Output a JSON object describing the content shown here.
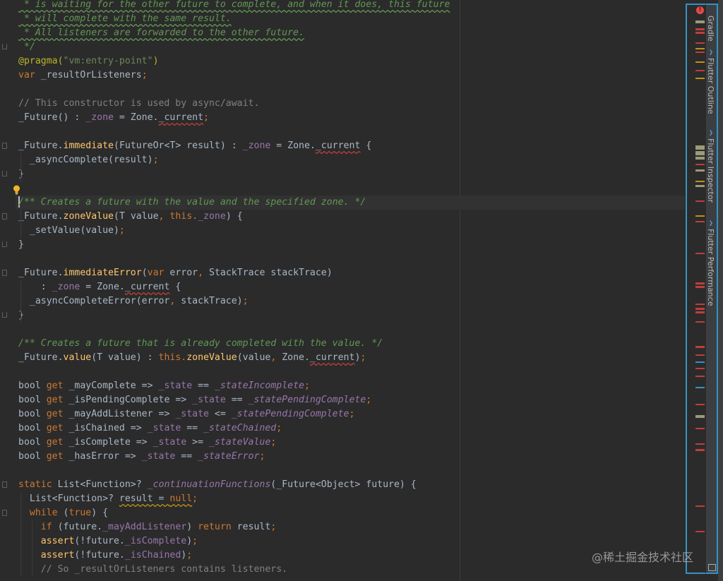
{
  "editor": {
    "lines": [
      [
        [
          "doc",
          " * is waiting for the other future to complete, and when it does, this future"
        ]
      ],
      [
        [
          "doc",
          " * will complete with the same result."
        ]
      ],
      [
        [
          "doc",
          " * All listeners are forwarded to the other future."
        ]
      ],
      [
        [
          "doc",
          " */"
        ]
      ],
      [
        [
          "ann",
          "@pragma("
        ],
        [
          "str",
          "\"vm:entry-point\""
        ],
        [
          "ann",
          ")"
        ]
      ],
      [
        [
          "kw",
          "var "
        ],
        [
          "plain",
          "_resultOrListeners"
        ],
        [
          "kw",
          ";"
        ]
      ],
      [],
      [
        [
          "cmt",
          "// This constructor is used by async/await."
        ]
      ],
      [
        [
          "plain",
          "_Future() : "
        ],
        [
          "prop-n",
          "_zone"
        ],
        [
          "plain",
          " = Zone."
        ],
        [
          "err",
          "_current"
        ],
        [
          "kw",
          ";"
        ]
      ],
      [],
      [
        [
          "plain",
          "_Future."
        ],
        [
          "fn",
          "immediate"
        ],
        [
          "plain",
          "(FutureOr<T> result) : "
        ],
        [
          "prop-n",
          "_zone"
        ],
        [
          "plain",
          " = Zone."
        ],
        [
          "err",
          "_current"
        ],
        [
          "plain",
          " {"
        ]
      ],
      [
        [
          "plain",
          "  _asyncComplete(result)"
        ],
        [
          "kw",
          ";"
        ]
      ],
      [
        [
          "plain",
          "}"
        ]
      ],
      [],
      [
        [
          "doc",
          "/** Creates a future with the value and the specified zone. */"
        ]
      ],
      [
        [
          "plain",
          "_Future."
        ],
        [
          "fn",
          "zoneValue"
        ],
        [
          "plain",
          "(T value"
        ],
        [
          "kw",
          ", this."
        ],
        [
          "prop-n",
          "_zone"
        ],
        [
          "plain",
          ") {"
        ]
      ],
      [
        [
          "plain",
          "  _setValue(value)"
        ],
        [
          "kw",
          ";"
        ]
      ],
      [
        [
          "plain",
          "}"
        ]
      ],
      [],
      [
        [
          "plain",
          "_Future."
        ],
        [
          "fn",
          "immediateError"
        ],
        [
          "plain",
          "("
        ],
        [
          "kw",
          "var "
        ],
        [
          "plain",
          "error"
        ],
        [
          "kw",
          ", "
        ],
        [
          "plain",
          "StackTrace stackTrace)"
        ]
      ],
      [
        [
          "plain",
          "    : "
        ],
        [
          "prop-n",
          "_zone"
        ],
        [
          "plain",
          " = Zone."
        ],
        [
          "err",
          "_current"
        ],
        [
          "plain",
          " {"
        ]
      ],
      [
        [
          "plain",
          "  _asyncCompleteError(error"
        ],
        [
          "kw",
          ", "
        ],
        [
          "plain",
          "stackTrace)"
        ],
        [
          "kw",
          ";"
        ]
      ],
      [
        [
          "plain",
          "}"
        ]
      ],
      [],
      [
        [
          "doc",
          "/** Creates a future that is already completed with the value. */"
        ]
      ],
      [
        [
          "plain",
          "_Future."
        ],
        [
          "fn",
          "value"
        ],
        [
          "plain",
          "(T value) : "
        ],
        [
          "kw",
          "this."
        ],
        [
          "fn",
          "zoneValue"
        ],
        [
          "plain",
          "(value"
        ],
        [
          "kw",
          ", "
        ],
        [
          "plain",
          "Zone."
        ],
        [
          "err",
          "_current"
        ],
        [
          "plain",
          ")"
        ],
        [
          "kw",
          ";"
        ]
      ],
      [],
      [
        [
          "plain",
          "bool "
        ],
        [
          "kw",
          "get "
        ],
        [
          "plain",
          "_mayComplete => "
        ],
        [
          "prop-n",
          "_state"
        ],
        [
          "plain",
          " == "
        ],
        [
          "prop",
          "_stateIncomplete"
        ],
        [
          "kw",
          ";"
        ]
      ],
      [
        [
          "plain",
          "bool "
        ],
        [
          "kw",
          "get "
        ],
        [
          "plain",
          "_isPendingComplete => "
        ],
        [
          "prop-n",
          "_state"
        ],
        [
          "plain",
          " == "
        ],
        [
          "prop",
          "_statePendingComplete"
        ],
        [
          "kw",
          ";"
        ]
      ],
      [
        [
          "plain",
          "bool "
        ],
        [
          "kw",
          "get "
        ],
        [
          "plain",
          "_mayAddListener => "
        ],
        [
          "prop-n",
          "_state"
        ],
        [
          "plain",
          " <= "
        ],
        [
          "prop",
          "_statePendingComplete"
        ],
        [
          "kw",
          ";"
        ]
      ],
      [
        [
          "plain",
          "bool "
        ],
        [
          "kw",
          "get "
        ],
        [
          "plain",
          "_isChained => "
        ],
        [
          "prop-n",
          "_state"
        ],
        [
          "plain",
          " == "
        ],
        [
          "prop",
          "_stateChained"
        ],
        [
          "kw",
          ";"
        ]
      ],
      [
        [
          "plain",
          "bool "
        ],
        [
          "kw",
          "get "
        ],
        [
          "plain",
          "_isComplete => "
        ],
        [
          "prop-n",
          "_state"
        ],
        [
          "plain",
          " >= "
        ],
        [
          "prop",
          "_stateValue"
        ],
        [
          "kw",
          ";"
        ]
      ],
      [
        [
          "plain",
          "bool "
        ],
        [
          "kw",
          "get "
        ],
        [
          "plain",
          "_hasError => "
        ],
        [
          "prop-n",
          "_state"
        ],
        [
          "plain",
          " == "
        ],
        [
          "prop",
          "_stateError"
        ],
        [
          "kw",
          ";"
        ]
      ],
      [],
      [
        [
          "kw",
          "static "
        ],
        [
          "plain",
          "List<Function>? "
        ],
        [
          "prop",
          "_continuationFunctions"
        ],
        [
          "plain",
          "(_Future<Object> future) {"
        ]
      ],
      [
        [
          "plain",
          "  List<Function>? "
        ],
        [
          "warn",
          "result = "
        ],
        [
          "kw-warn",
          "null"
        ],
        [
          "kw",
          ";"
        ]
      ],
      [
        [
          "kw",
          "  while "
        ],
        [
          "plain",
          "("
        ],
        [
          "kw",
          "true"
        ],
        [
          "plain",
          ") {"
        ]
      ],
      [
        [
          "kw",
          "    if "
        ],
        [
          "plain",
          "(future."
        ],
        [
          "prop-n",
          "_mayAddListener"
        ],
        [
          "plain",
          ") "
        ],
        [
          "kw",
          "return "
        ],
        [
          "plain",
          "result"
        ],
        [
          "kw",
          ";"
        ]
      ],
      [
        [
          "fn",
          "    assert"
        ],
        [
          "plain",
          "(!future."
        ],
        [
          "prop-n",
          "_isComplete"
        ],
        [
          "plain",
          ")"
        ],
        [
          "kw",
          ";"
        ]
      ],
      [
        [
          "fn",
          "    assert"
        ],
        [
          "plain",
          "(!future."
        ],
        [
          "prop-n",
          "_isChained"
        ],
        [
          "plain",
          ")"
        ],
        [
          "kw",
          ";"
        ]
      ],
      [
        [
          "cmt",
          "    // So _resultOrListeners contains listeners."
        ]
      ]
    ],
    "current_line_index": 14
  },
  "tool_windows": [
    "Gradle",
    "Flutter Outline",
    "Flutter Inspector",
    "Flutter Performance"
  ],
  "inspection_marker": "!",
  "icons": {
    "intention_bulb": "lightbulb-icon",
    "inspection_status": "error-icon",
    "tool_window_flutter": "flutter-icon"
  },
  "error_stripe": {
    "colors": {
      "error": "#bc3f3c",
      "warning": "#be9117",
      "info": "#3592c4",
      "change": "#9a9a7a"
    }
  },
  "watermark": "@稀土掘金技术社区"
}
